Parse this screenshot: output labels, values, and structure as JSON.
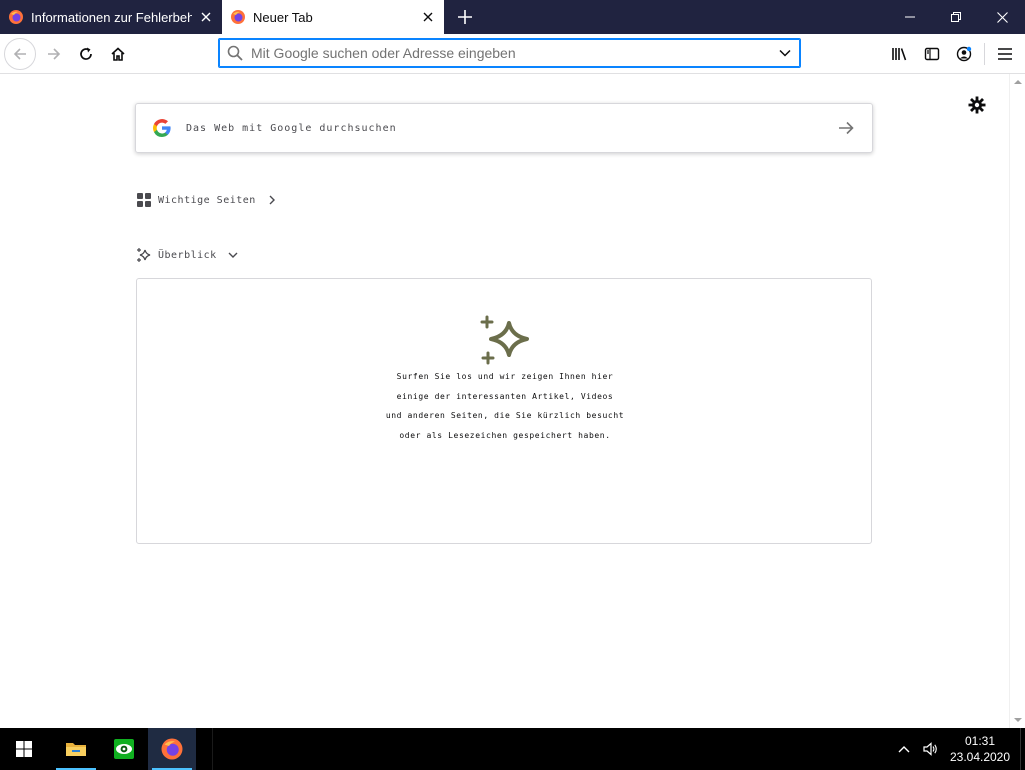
{
  "browser": {
    "tabs": [
      {
        "title": "Informationen zur Fehlerbehebung",
        "icon": "firefox-icon",
        "active": false
      },
      {
        "title": "Neuer Tab",
        "icon": "firefox-icon",
        "active": true
      }
    ],
    "new_tab_icon": "plus-icon",
    "window_controls": [
      "minimize-icon",
      "restore-icon",
      "close-icon"
    ]
  },
  "navbar": {
    "url_placeholder": "Mit Google suchen oder Adresse eingeben",
    "url_value": "",
    "left_icons": [
      "back-icon",
      "forward-icon",
      "reload-icon",
      "home-icon"
    ],
    "right_icons": [
      "library-icon",
      "sidebar-icon",
      "account-icon",
      "menu-icon"
    ]
  },
  "newtab": {
    "search_text": "Das Web mit Google durchsuchen",
    "topsites_label": "Wichtige Seiten",
    "highlights_label": "Überblick",
    "highlights_message": [
      "Surfen Sie los und wir zeigen Ihnen hier",
      "einige der interessanten Artikel, Videos",
      "und anderen Seiten, die Sie kürzlich besucht",
      "oder als Lesezeichen gespeichert haben."
    ],
    "colors": {
      "accent": "#0a84ff",
      "icon_olive": "#6b6e4b"
    }
  },
  "taskbar": {
    "apps": [
      "file-explorer-icon",
      "eye-app-icon",
      "firefox-icon"
    ],
    "active_app": "firefox-icon",
    "time": "01:31",
    "date": "23.04.2020"
  }
}
